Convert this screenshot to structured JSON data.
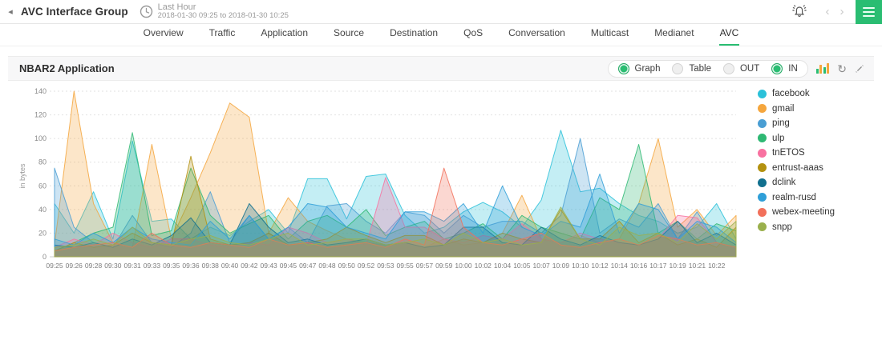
{
  "header": {
    "back_glyph": "◂",
    "title": "AVC Interface Group",
    "time_range_label": "Last Hour",
    "time_range_detail": "2018-01-30 09:25 to 2018-01-30 10:25"
  },
  "nav_tabs": {
    "active": "AVC",
    "items": [
      {
        "label": "Overview"
      },
      {
        "label": "Traffic"
      },
      {
        "label": "Application"
      },
      {
        "label": "Source"
      },
      {
        "label": "Destination"
      },
      {
        "label": "QoS"
      },
      {
        "label": "Conversation"
      },
      {
        "label": "Multicast"
      },
      {
        "label": "Medianet"
      },
      {
        "label": "AVC"
      }
    ]
  },
  "panel": {
    "title": "NBAR2 Application",
    "toggles": [
      {
        "label": "Graph",
        "selected": true
      },
      {
        "label": "Table",
        "selected": false
      },
      {
        "label": "OUT",
        "selected": false
      },
      {
        "label": "IN",
        "selected": true
      }
    ],
    "icons": [
      "bar-chart-icon",
      "refresh-icon",
      "expand-icon"
    ],
    "refresh_glyph": "↻"
  },
  "colors": {
    "accent_green": "#2abd72",
    "grid": "#e2e2e2",
    "axis_text": "#8a8a8a",
    "panel_header_bg": "#f7f7f8"
  },
  "chart_data": {
    "type": "area",
    "title": "NBAR2 Application",
    "ylabel": "in bytes",
    "ylim": [
      0,
      140
    ],
    "y_ticks": [
      0,
      20,
      40,
      60,
      80,
      100,
      120,
      140
    ],
    "grid": "horizontal-dashed",
    "legend_position": "right",
    "x_labels": [
      "09:25",
      "09:26",
      "09:28",
      "09:30",
      "09:31",
      "09:33",
      "09:35",
      "09:36",
      "09:38",
      "09:40",
      "09:42",
      "09:43",
      "09:45",
      "09:47",
      "09:48",
      "09:50",
      "09:52",
      "09:53",
      "09:55",
      "09:57",
      "09:59",
      "10:00",
      "10:02",
      "10:04",
      "10:05",
      "10:07",
      "10:09",
      "10:10",
      "10:12",
      "10:14",
      "10:16",
      "10:17",
      "10:19",
      "10:21",
      "10:22"
    ],
    "series": [
      {
        "name": "facebook",
        "color": "#2bc1d9",
        "values": [
          45,
          20,
          55,
          15,
          98,
          30,
          32,
          15,
          25,
          18,
          30,
          40,
          20,
          66,
          66,
          32,
          68,
          70,
          35,
          20,
          25,
          38,
          46,
          38,
          25,
          48,
          107,
          55,
          58,
          45,
          35,
          30,
          20,
          25,
          45,
          15
        ]
      },
      {
        "name": "gmail",
        "color": "#f5a63d",
        "values": [
          10,
          140,
          45,
          12,
          8,
          95,
          15,
          50,
          88,
          130,
          118,
          20,
          50,
          30,
          22,
          15,
          12,
          10,
          12,
          8,
          15,
          10,
          12,
          20,
          52,
          15,
          12,
          18,
          12,
          15,
          45,
          100,
          25,
          40,
          18,
          35
        ]
      },
      {
        "name": "ping",
        "color": "#4a9ed3",
        "values": [
          75,
          25,
          12,
          8,
          35,
          12,
          8,
          20,
          55,
          12,
          35,
          15,
          25,
          12,
          43,
          45,
          30,
          20,
          38,
          35,
          20,
          35,
          25,
          30,
          30,
          20,
          35,
          100,
          20,
          32,
          25,
          45,
          15,
          38,
          12,
          8
        ]
      },
      {
        "name": "ulp",
        "color": "#2eb873",
        "values": [
          5,
          12,
          20,
          25,
          105,
          18,
          22,
          75,
          35,
          20,
          28,
          35,
          15,
          30,
          35,
          25,
          40,
          18,
          25,
          30,
          15,
          20,
          28,
          15,
          35,
          25,
          20,
          15,
          50,
          40,
          95,
          20,
          30,
          15,
          28,
          22
        ]
      },
      {
        "name": "tnETOS",
        "color": "#f871a0",
        "values": [
          8,
          15,
          10,
          20,
          12,
          8,
          15,
          15,
          10,
          8,
          12,
          10,
          25,
          20,
          12,
          15,
          10,
          67,
          25,
          25,
          15,
          12,
          18,
          15,
          28,
          15,
          12,
          20,
          15,
          12,
          10,
          15,
          35,
          33,
          12,
          8
        ]
      },
      {
        "name": "entrust-aaas",
        "color": "#b3910f",
        "values": [
          5,
          12,
          8,
          10,
          20,
          12,
          10,
          85,
          15,
          10,
          12,
          20,
          10,
          12,
          15,
          25,
          18,
          12,
          18,
          18,
          10,
          15,
          12,
          20,
          15,
          12,
          40,
          15,
          15,
          30,
          12,
          20,
          10,
          15,
          8,
          25
        ]
      },
      {
        "name": "dclink",
        "color": "#11708e",
        "values": [
          10,
          8,
          12,
          8,
          15,
          10,
          18,
          33,
          12,
          10,
          45,
          25,
          12,
          15,
          10,
          12,
          15,
          10,
          12,
          8,
          10,
          25,
          25,
          12,
          10,
          25,
          15,
          10,
          18,
          12,
          10,
          15,
          30,
          12,
          20,
          10
        ]
      },
      {
        "name": "realm-rusd",
        "color": "#2f9fd8",
        "values": [
          15,
          10,
          20,
          12,
          25,
          15,
          12,
          10,
          30,
          15,
          35,
          15,
          25,
          45,
          42,
          25,
          20,
          15,
          38,
          38,
          30,
          45,
          20,
          60,
          25,
          18,
          30,
          25,
          70,
          20,
          45,
          40,
          15,
          30,
          25,
          12
        ]
      },
      {
        "name": "webex-meeting",
        "color": "#f2705b",
        "values": [
          5,
          8,
          10,
          12,
          8,
          20,
          10,
          8,
          12,
          10,
          8,
          15,
          10,
          12,
          8,
          10,
          12,
          8,
          15,
          10,
          75,
          25,
          12,
          10,
          15,
          20,
          10,
          8,
          12,
          15,
          10,
          18,
          15,
          10,
          12,
          8
        ]
      },
      {
        "name": "snpp",
        "color": "#9ab04c",
        "values": [
          8,
          10,
          15,
          10,
          25,
          12,
          10,
          15,
          18,
          12,
          10,
          15,
          20,
          10,
          12,
          15,
          15,
          10,
          12,
          15,
          10,
          20,
          12,
          15,
          10,
          12,
          42,
          15,
          10,
          25,
          18,
          20,
          12,
          28,
          15,
          30
        ]
      }
    ]
  }
}
